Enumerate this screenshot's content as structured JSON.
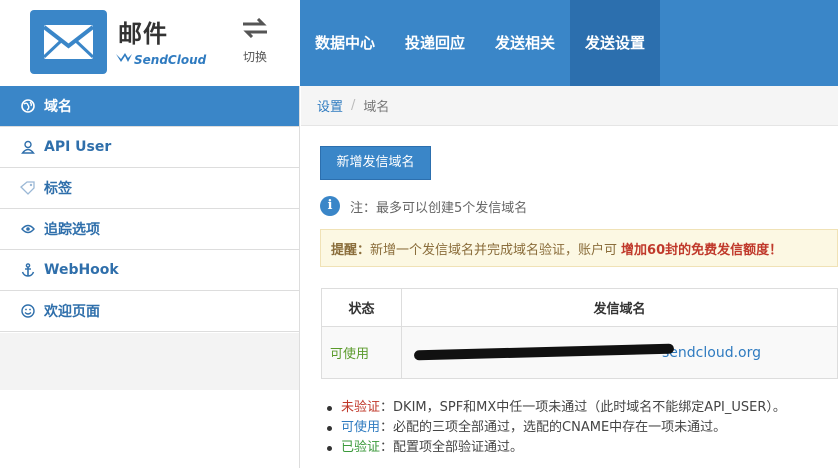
{
  "app": {
    "title": "邮件",
    "brand": "SendCloud"
  },
  "header": {
    "switch_label": "切换"
  },
  "topnav": [
    {
      "label": "数据中心"
    },
    {
      "label": "投递回应"
    },
    {
      "label": "发送相关"
    },
    {
      "label": "发送设置",
      "active": true
    }
  ],
  "sidebar": {
    "items": [
      {
        "label": "域名",
        "icon": "globe-icon",
        "active": true
      },
      {
        "label": "API User",
        "icon": "user-icon"
      },
      {
        "label": "标签",
        "icon": "tag-icon"
      },
      {
        "label": "追踪选项",
        "icon": "eye-icon"
      },
      {
        "label": "WebHook",
        "icon": "anchor-icon"
      },
      {
        "label": "欢迎页面",
        "icon": "smile-icon"
      }
    ]
  },
  "breadcrumb": {
    "parent": "设置",
    "separator": "/",
    "current": "域名"
  },
  "main": {
    "add_button": "新增发信域名",
    "note": "注：最多可以创建5个发信域名",
    "alert": {
      "prefix": "提醒：",
      "text": "新增一个发信域名并完成域名验证，账户可",
      "emphasis": "增加60封的免费发信额度！"
    },
    "table": {
      "headers": {
        "status": "状态",
        "domain": "发信域名"
      },
      "rows": [
        {
          "status": "可使用",
          "domain": "sendcloud.org"
        }
      ]
    },
    "legend": [
      {
        "key": "未验证",
        "sep": "：",
        "text": "DKIM，SPF和MX中任一项未通过（此时域名不能绑定API_USER）。"
      },
      {
        "key": "可使用",
        "sep": "：",
        "text": "必配的三项全部通过，选配的CNAME中存在一项未通过。"
      },
      {
        "key": "已验证",
        "sep": "：",
        "text": "配置项全部验证通过。"
      }
    ]
  },
  "colors": {
    "primary": "#3a86c8",
    "active_nav": "#2c6fae",
    "alert_bg": "#fcf8e3",
    "danger": "#c0392b",
    "success": "#3c9a3c"
  }
}
